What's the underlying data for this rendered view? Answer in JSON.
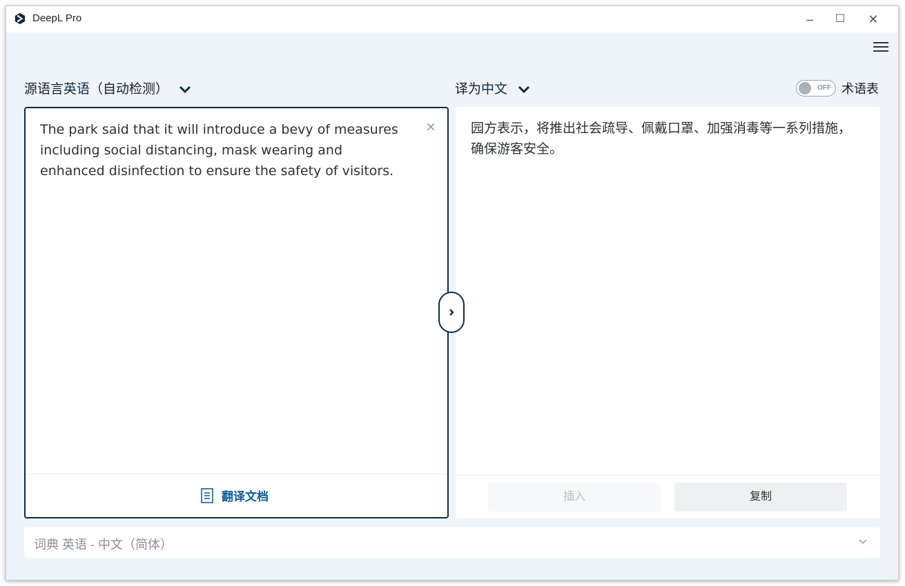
{
  "window": {
    "title": "DeepL Pro",
    "minimize": "–",
    "maximize": "☐",
    "close": "✕"
  },
  "colors": {
    "accent": "#0f2b46",
    "link": "#0f5fa0",
    "background": "#eef4fa"
  },
  "source": {
    "label_prefix": "源语言",
    "label_language": "英语",
    "label_detected": "（自动检测）",
    "text": "The park said that it will introduce a bevy of measures including social distancing, mask wearing and enhanced disinfection to ensure the safety of visitors.",
    "clear_glyph": "×",
    "translate_doc_label": "翻译文档"
  },
  "target": {
    "label_prefix": "译为",
    "label_language": "中文",
    "text": "园方表示，将推出社会疏导、佩戴口罩、加强消毒等一系列措施，确保游客安全。",
    "insert_label": "插入",
    "copy_label": "复制"
  },
  "glossary": {
    "toggle_state": "OFF",
    "label": "术语表"
  },
  "dictionary": {
    "label": "词典 英语 - 中文（简体）"
  },
  "icons": {
    "logo": "deepl-logo-icon",
    "menu": "hamburger-menu-icon",
    "swap": "chevron-right-icon",
    "document": "document-icon",
    "dropdown": "chevron-down-icon"
  }
}
